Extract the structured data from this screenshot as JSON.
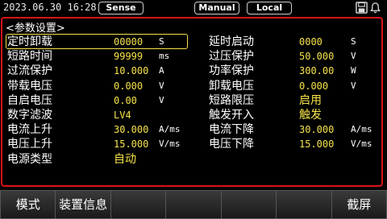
{
  "status": {
    "datetime": "2023.06.30 16:28",
    "sense": "Sense",
    "mode": "Manual",
    "control": "Local",
    "icons": [
      "save-icon",
      "bell-icon"
    ]
  },
  "panel": {
    "title": "<参数设置>",
    "left": [
      {
        "label": "定时卸载",
        "value": "00000",
        "unit": "S"
      },
      {
        "label": "短路时间",
        "value": "99999",
        "unit": "ms"
      },
      {
        "label": "过流保护",
        "value": "10.000",
        "unit": "A"
      },
      {
        "label": "带载电压",
        "value": "0.000",
        "unit": "V"
      },
      {
        "label": "自启电压",
        "value": "0.00",
        "unit": "V"
      },
      {
        "label": "数字滤波",
        "value": "LV4",
        "unit": ""
      },
      {
        "label": "电流上升",
        "value": "30.000",
        "unit": "A/ms"
      },
      {
        "label": "电压上升",
        "value": "15.000",
        "unit": "V/ms"
      },
      {
        "label": "电源类型",
        "value": "自动",
        "unit": ""
      }
    ],
    "right": [
      {
        "label": "延时启动",
        "value": "0000",
        "unit": "S"
      },
      {
        "label": "过压保护",
        "value": "50.000",
        "unit": "V"
      },
      {
        "label": "功率保护",
        "value": "300.00",
        "unit": "W"
      },
      {
        "label": "卸载电压",
        "value": "0.000",
        "unit": "V"
      },
      {
        "label": "短路限压",
        "value": "启用",
        "unit": ""
      },
      {
        "label": "触发开入",
        "value": "触发",
        "unit": ""
      },
      {
        "label": "电流下降",
        "value": "30.000",
        "unit": "A/ms"
      },
      {
        "label": "电压下降",
        "value": "15.000",
        "unit": "V/ms"
      }
    ]
  },
  "softkeys": [
    "模式",
    "装置信息",
    "",
    "",
    "",
    "",
    "截屏"
  ],
  "colors": {
    "accent": "#d8141c",
    "value": "#f5e34a"
  }
}
